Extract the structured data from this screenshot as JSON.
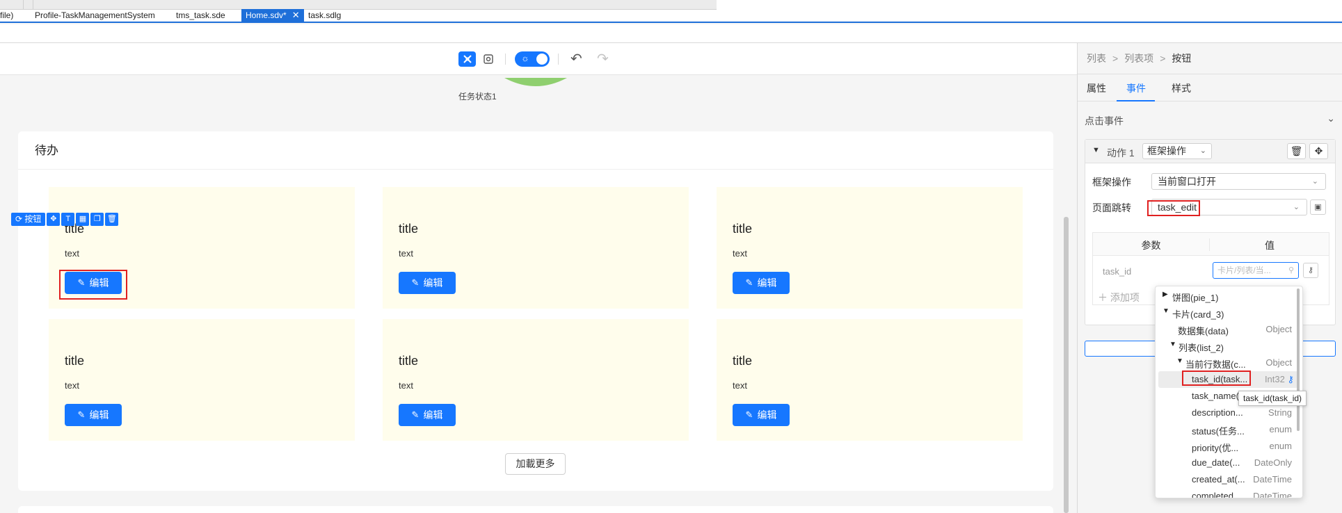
{
  "tabs": [
    {
      "label": "file)"
    },
    {
      "label": "Profile-TaskManagementSystem"
    },
    {
      "label": "tms_task.sde"
    },
    {
      "label": "Home.sdv*",
      "close": "✕"
    },
    {
      "label": "task.sdlg"
    }
  ],
  "canvas": {
    "pie_label": "任务状态1",
    "card_title": "待办",
    "items": [
      {
        "title": "title",
        "text": "text",
        "button": "编辑"
      },
      {
        "title": "title",
        "text": "text",
        "button": "编辑"
      },
      {
        "title": "title",
        "text": "text",
        "button": "编辑"
      },
      {
        "title": "title",
        "text": "text",
        "button": "编辑"
      },
      {
        "title": "title",
        "text": "text",
        "button": "编辑"
      },
      {
        "title": "title",
        "text": "text",
        "button": "编辑"
      }
    ],
    "selection_label": "按钮",
    "load_more": "加載更多"
  },
  "panel": {
    "breadcrumb": [
      "列表",
      "列表项",
      "按钮"
    ],
    "breadcrumb_sep": ">",
    "tabs": [
      "属性",
      "事件",
      "样式"
    ],
    "active_tab": "事件",
    "section_title": "点击事件",
    "action": {
      "label": "动作 1",
      "type_value": "框架操作"
    },
    "form": {
      "frame_op_label": "框架操作",
      "frame_op_value": "当前窗口打开",
      "page_jump_label": "页面跳转",
      "page_jump_value": "task_edit"
    },
    "params_table": {
      "col_param": "参数",
      "col_value": "值",
      "row_param": "task_id",
      "row_value_placeholder": "卡片/列表/当...",
      "add_item": "添加项"
    }
  },
  "tree": {
    "nodes": [
      {
        "name": "饼图(pie_1)",
        "type": "",
        "arrow": "right"
      },
      {
        "name": "卡片(card_3)",
        "type": "",
        "arrow": "down"
      },
      {
        "name": "数据集(data)",
        "type": "Object",
        "arrow": ""
      },
      {
        "name": "列表(list_2)",
        "type": "",
        "arrow": "down"
      },
      {
        "name": "当前行数据(c...",
        "type": "Object",
        "arrow": "down"
      },
      {
        "name": "task_id(task...",
        "type": "Int32",
        "arrow": ""
      },
      {
        "name": "task_name(",
        "type": "",
        "arrow": ""
      },
      {
        "name": "description...",
        "type": "String",
        "arrow": ""
      },
      {
        "name": "status(任务...",
        "type": "enum",
        "arrow": ""
      },
      {
        "name": "priority(优...",
        "type": "enum",
        "arrow": ""
      },
      {
        "name": "due_date(...",
        "type": "DateOnly",
        "arrow": ""
      },
      {
        "name": "created_at(...",
        "type": "DateTime",
        "arrow": ""
      },
      {
        "name": "completed_...",
        "type": "DateTime",
        "arrow": ""
      }
    ],
    "tooltip": "task_id(task_id)"
  },
  "colors": {
    "accent": "#1677ff",
    "highlight_box": "#e02020",
    "item_bg": "#fffdec"
  }
}
